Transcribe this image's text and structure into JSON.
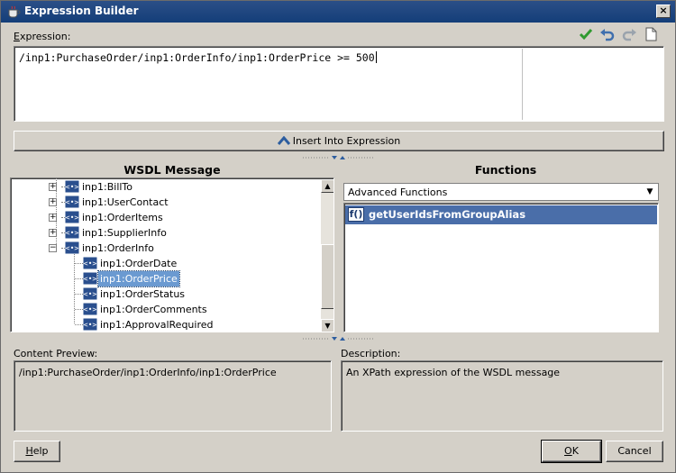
{
  "window": {
    "title": "Expression Builder",
    "close_glyph": "×"
  },
  "expression": {
    "label_mnemonic": "E",
    "label_rest": "xpression:",
    "value": "/inp1:PurchaseOrder/inp1:OrderInfo/inp1:OrderPrice >= 500"
  },
  "toolbar": {
    "icons": [
      "checkmark-icon",
      "undo-icon",
      "redo-icon",
      "new-document-icon"
    ]
  },
  "insert_button": {
    "label": "Insert Into Expression"
  },
  "wsdl_panel": {
    "title": "WSDL Message",
    "items": [
      {
        "label": "inp1:BillTo",
        "expander": "+"
      },
      {
        "label": "inp1:UserContact",
        "expander": "+"
      },
      {
        "label": "inp1:OrderItems",
        "expander": "+"
      },
      {
        "label": "inp1:SupplierInfo",
        "expander": "+"
      },
      {
        "label": "inp1:OrderInfo",
        "expander": "−"
      },
      {
        "label": "inp1:OrderDate"
      },
      {
        "label": "inp1:OrderPrice",
        "selected": true
      },
      {
        "label": "inp1:OrderStatus"
      },
      {
        "label": "inp1:OrderComments"
      },
      {
        "label": "inp1:ApprovalRequired"
      }
    ]
  },
  "functions_panel": {
    "title": "Functions",
    "dropdown_value": "Advanced Functions",
    "items": [
      {
        "icon_text": "f()",
        "label": "getUserIdsFromGroupAlias"
      }
    ]
  },
  "content_preview": {
    "label": "Content Preview:",
    "value": "/inp1:PurchaseOrder/inp1:OrderInfo/inp1:OrderPrice"
  },
  "description": {
    "label": "Description:",
    "value": "An XPath expression of the WSDL message"
  },
  "buttons": {
    "help_mnemonic": "H",
    "help_rest": "elp",
    "ok_mnemonic": "O",
    "ok_rest": "K",
    "cancel_label": "Cancel"
  },
  "colors": {
    "title_bar": "#143e79",
    "selection": "#4a6ea9",
    "tree_selection": "#6b9ad1"
  }
}
